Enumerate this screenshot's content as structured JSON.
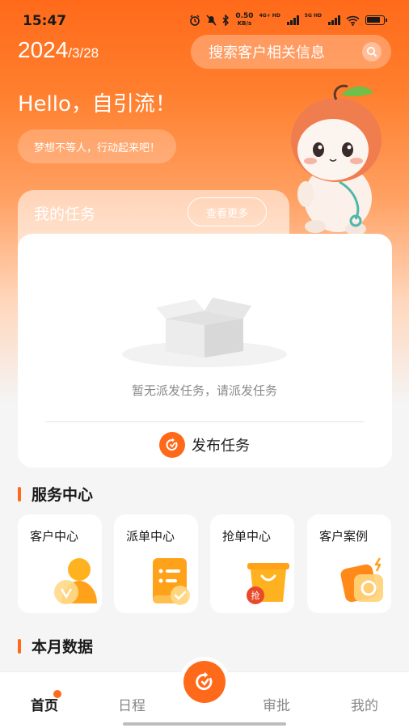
{
  "status_bar": {
    "time": "15:47",
    "net_speed": "0.50",
    "net_unit": "KB/s",
    "sim1": "4G+ HD",
    "sim2": "5G HD"
  },
  "header": {
    "date_year": "2024",
    "date_md": "/3/28",
    "search_placeholder": "搜索客户相关信息",
    "greeting": "Hello，自引流！",
    "motto": "梦想不等人，行动起来吧！"
  },
  "tasks": {
    "title": "我的任务",
    "more_label": "查看更多",
    "empty_text": "暂无派发任务，请派发任务",
    "publish_label": "发布任务"
  },
  "service_center": {
    "title": "服务中心",
    "items": [
      {
        "label": "客户中心",
        "icon": "customer-center-icon"
      },
      {
        "label": "派单中心",
        "icon": "dispatch-center-icon"
      },
      {
        "label": "抢单中心",
        "icon": "grab-order-icon",
        "badge": "抢"
      },
      {
        "label": "客户案例",
        "icon": "customer-case-icon"
      }
    ]
  },
  "monthly_data": {
    "title": "本月数据"
  },
  "bottom_nav": {
    "items": [
      {
        "label": "首页",
        "active": true
      },
      {
        "label": "日程",
        "active": false
      },
      {
        "label": "审批",
        "active": false
      },
      {
        "label": "我的",
        "active": false
      }
    ]
  },
  "colors": {
    "accent": "#ff6a1a",
    "background": "#f5f5f5"
  }
}
